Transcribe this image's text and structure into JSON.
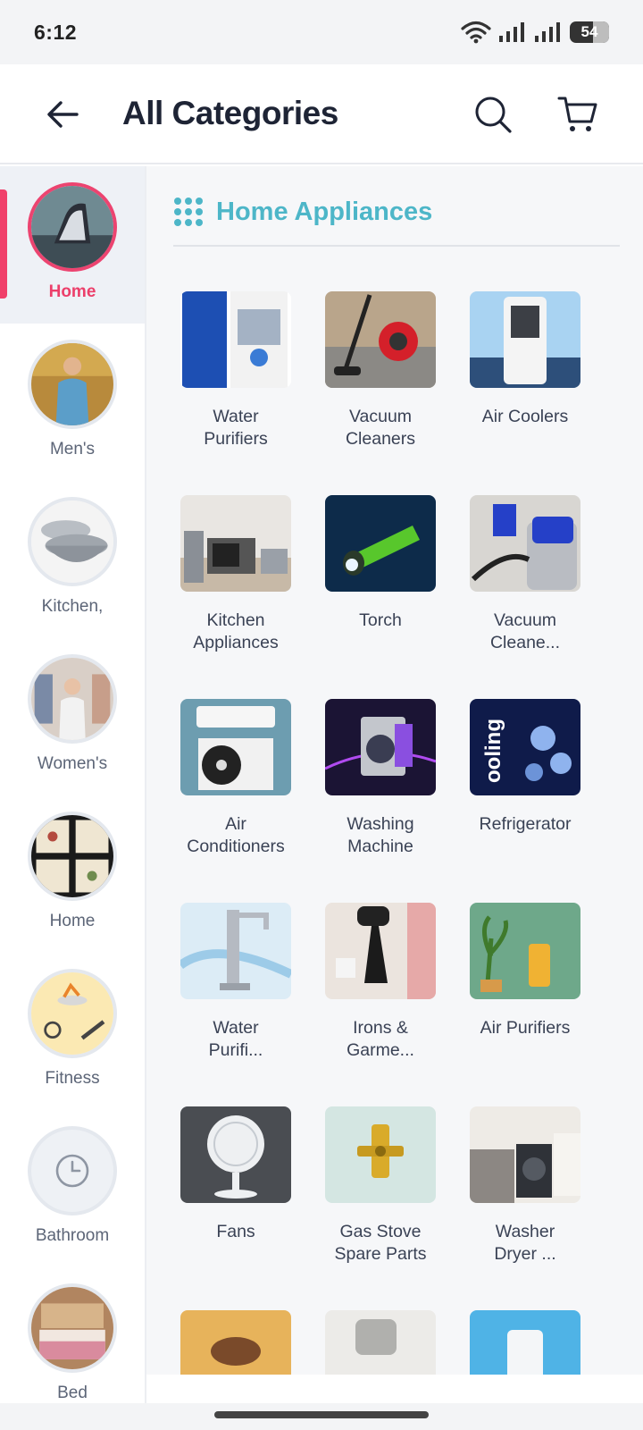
{
  "status_bar": {
    "time": "6:12",
    "battery": "54"
  },
  "header": {
    "title": "All Categories"
  },
  "sidebar": {
    "items": [
      {
        "label": "Home",
        "active": true,
        "thumb": "iron"
      },
      {
        "label": "Men's",
        "active": false,
        "thumb": "man"
      },
      {
        "label": "Kitchen,",
        "active": false,
        "thumb": "pots"
      },
      {
        "label": "Women's",
        "active": false,
        "thumb": "women"
      },
      {
        "label": "Home",
        "active": false,
        "thumb": "frames"
      },
      {
        "label": "Fitness",
        "active": false,
        "thumb": "gym"
      },
      {
        "label": "Bathroom",
        "active": false,
        "thumb": "clock-icon"
      },
      {
        "label": "Bed",
        "active": false,
        "thumb": "bed"
      }
    ]
  },
  "main": {
    "section_title": "Home Appliances",
    "items": [
      {
        "label": "Water\nPurifiers",
        "img": "purifier"
      },
      {
        "label": "Vacuum\nCleaners",
        "img": "vacuum"
      },
      {
        "label": "Air Coolers",
        "img": "cooler"
      },
      {
        "label": "Kitchen\nAppliances",
        "img": "kitchen"
      },
      {
        "label": "Torch",
        "img": "torch"
      },
      {
        "label": "Vacuum\nCleane...",
        "img": "shopvac"
      },
      {
        "label": "Air\nConditioners",
        "img": "ac"
      },
      {
        "label": "Washing\nMachine",
        "img": "washer"
      },
      {
        "label": "Refrigerator",
        "img": "fridge"
      },
      {
        "label": "Water\nPurifi...",
        "img": "tap"
      },
      {
        "label": "Irons &\nGarme...",
        "img": "steamer"
      },
      {
        "label": "Air Purifiers",
        "img": "airpurifier"
      },
      {
        "label": "Fans",
        "img": "fan"
      },
      {
        "label": "Gas Stove\nSpare Parts",
        "img": "valve"
      },
      {
        "label": "Washer\nDryer ...",
        "img": "dryer"
      },
      {
        "label": "",
        "img": "partial1"
      },
      {
        "label": "",
        "img": "partial2"
      },
      {
        "label": "",
        "img": "partial3"
      }
    ]
  }
}
